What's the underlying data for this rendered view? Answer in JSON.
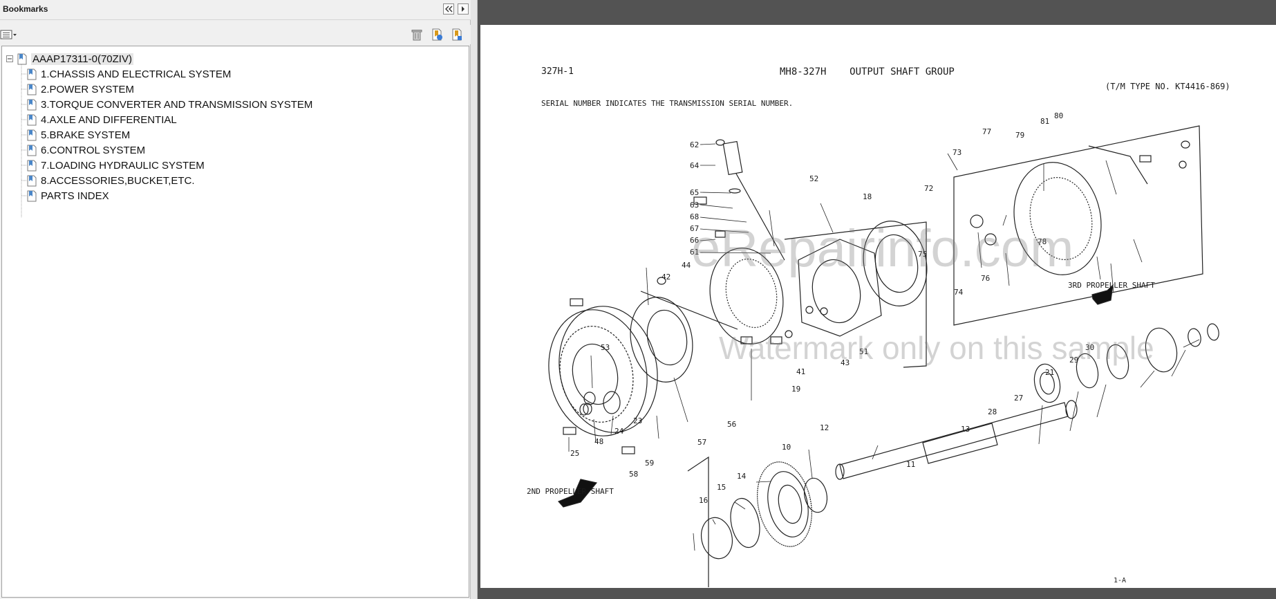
{
  "bookmarks_panel": {
    "title": "Bookmarks",
    "collapse_icon": "double-chevron-left-icon",
    "expand_icon": "chevron-right-icon",
    "options_icon": "list-options-icon",
    "delete_icon": "trash-icon",
    "new_bookmark_icon": "new-bookmark-icon",
    "expand_bookmark_icon": "bookmark-expand-icon",
    "root": {
      "label": "AAAP17311-0(70ZIV)",
      "expanded": true
    },
    "items": [
      {
        "label": "1.CHASSIS AND ELECTRICAL SYSTEM"
      },
      {
        "label": "2.POWER SYSTEM"
      },
      {
        "label": "3.TORQUE CONVERTER AND TRANSMISSION SYSTEM"
      },
      {
        "label": "4.AXLE AND DIFFERENTIAL"
      },
      {
        "label": "5.BRAKE SYSTEM"
      },
      {
        "label": "6.CONTROL SYSTEM"
      },
      {
        "label": "7.LOADING HYDRAULIC SYSTEM"
      },
      {
        "label": "8.ACCESSORIES,BUCKET,ETC."
      },
      {
        "label": "PARTS INDEX"
      }
    ]
  },
  "document": {
    "page_code": "327H-1",
    "title": "MH8-327H    OUTPUT SHAFT GROUP",
    "tm_type": "(T/M TYPE NO. KT4416-869)",
    "serial_note": "SERIAL NUMBER INDICATES THE TRANSMISSION SERIAL NUMBER.",
    "label_2nd_shaft": "2ND PROPELLER SHAFT",
    "label_3rd_shaft": "3RD PROPELLER SHAFT",
    "page_footer": "1-A",
    "watermark_1": "eRepairinfo.com",
    "watermark_2": "Watermark only on this sample",
    "part_numbers": [
      "62",
      "64",
      "65",
      "63",
      "68",
      "67",
      "66",
      "61",
      "52",
      "18",
      "42",
      "44",
      "53",
      "19",
      "51",
      "43",
      "41",
      "56",
      "57",
      "23",
      "24",
      "48",
      "25",
      "58",
      "59",
      "12",
      "10",
      "11",
      "13",
      "28",
      "27",
      "21",
      "29",
      "30",
      "73",
      "77",
      "79",
      "81",
      "80",
      "72",
      "75",
      "74",
      "76",
      "78",
      "14",
      "15",
      "16"
    ]
  },
  "colors": {
    "panel_bg": "#f0f0f0",
    "viewer_bg": "#535353",
    "page_bg": "#ffffff",
    "ink": "#1a1a1a"
  }
}
